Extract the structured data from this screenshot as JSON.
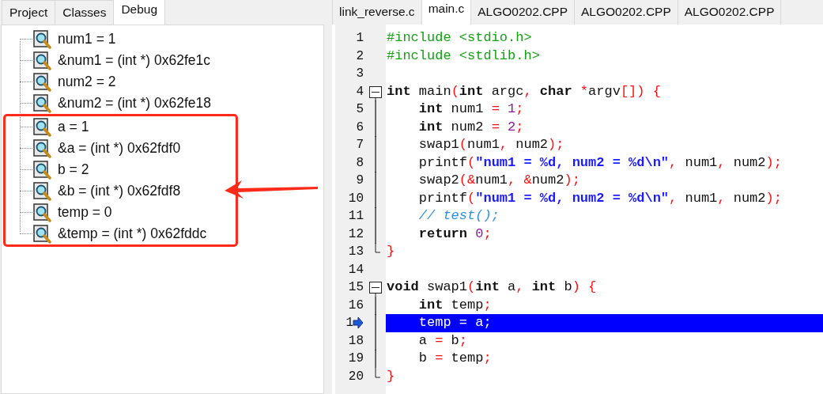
{
  "left_panel": {
    "tabs": [
      {
        "label": "Project",
        "selected": false
      },
      {
        "label": "Classes",
        "selected": false
      },
      {
        "label": "Debug",
        "selected": true
      }
    ],
    "watches": [
      {
        "label": "num1 = 1",
        "highlighted": false
      },
      {
        "label": "&num1 = (int *) 0x62fe1c",
        "highlighted": false
      },
      {
        "label": "num2 = 2",
        "highlighted": false
      },
      {
        "label": "&num2 = (int *) 0x62fe18",
        "highlighted": false
      },
      {
        "label": "a = 1",
        "highlighted": true
      },
      {
        "label": "&a = (int *) 0x62fdf0",
        "highlighted": true
      },
      {
        "label": "b = 2",
        "highlighted": true
      },
      {
        "label": "&b = (int *) 0x62fdf8",
        "highlighted": true
      },
      {
        "label": "temp = 0",
        "highlighted": true
      },
      {
        "label": "&temp = (int *) 0x62fddc",
        "highlighted": true
      }
    ]
  },
  "editor": {
    "tabs": [
      {
        "label": "link_reverse.c",
        "selected": false
      },
      {
        "label": "main.c",
        "selected": true
      },
      {
        "label": "ALGO0202.CPP",
        "selected": false
      },
      {
        "label": "ALGO0202.CPP",
        "selected": false
      },
      {
        "label": "ALGO0202.CPP",
        "selected": false
      }
    ],
    "lines": [
      {
        "number": "1",
        "current": false,
        "tokens": [
          {
            "kind": "preprocessor",
            "t": "#include <stdio.h>"
          }
        ]
      },
      {
        "number": "2",
        "current": false,
        "tokens": [
          {
            "kind": "preprocessor",
            "t": "#include <stdlib.h>"
          }
        ]
      },
      {
        "number": "3",
        "current": false
      },
      {
        "number": "4",
        "fold_toggle": true,
        "current": false,
        "tokens": [
          {
            "kind": "keyword",
            "t": "int"
          },
          {
            "kind": "identifier",
            "t": " main"
          },
          {
            "kind": "symbol",
            "t": "("
          },
          {
            "kind": "keyword",
            "t": "int"
          },
          {
            "kind": "identifier",
            "t": " argc"
          },
          {
            "kind": "symbol",
            "t": ","
          },
          {
            "kind": "keyword",
            "t": " char"
          },
          {
            "kind": "symbol",
            "t": " *"
          },
          {
            "kind": "identifier",
            "t": "argv"
          },
          {
            "kind": "symbol",
            "t": "[]) {"
          }
        ]
      },
      {
        "number": "5",
        "in_block": true,
        "current": false,
        "tokens": [
          {
            "kind": "keyword",
            "t": "    int"
          },
          {
            "kind": "identifier",
            "t": " num1 "
          },
          {
            "kind": "symbol",
            "t": "="
          },
          {
            "kind": "number",
            "t": " 1"
          },
          {
            "kind": "symbol",
            "t": ";"
          }
        ]
      },
      {
        "number": "6",
        "in_block": true,
        "current": false,
        "tokens": [
          {
            "kind": "keyword",
            "t": "    int"
          },
          {
            "kind": "identifier",
            "t": " num2 "
          },
          {
            "kind": "symbol",
            "t": "="
          },
          {
            "kind": "number",
            "t": " 2"
          },
          {
            "kind": "symbol",
            "t": ";"
          }
        ]
      },
      {
        "number": "7",
        "in_block": true,
        "current": false,
        "tokens": [
          {
            "kind": "identifier",
            "t": "    swap1"
          },
          {
            "kind": "symbol",
            "t": "("
          },
          {
            "kind": "identifier",
            "t": "num1"
          },
          {
            "kind": "symbol",
            "t": ","
          },
          {
            "kind": "identifier",
            "t": " num2"
          },
          {
            "kind": "symbol",
            "t": ");"
          }
        ]
      },
      {
        "number": "8",
        "in_block": true,
        "current": false,
        "tokens": [
          {
            "kind": "identifier",
            "t": "    printf"
          },
          {
            "kind": "symbol",
            "t": "("
          },
          {
            "kind": "string",
            "t": "\"num1 = %d, num2 = %d\\n\""
          },
          {
            "kind": "symbol",
            "t": ","
          },
          {
            "kind": "identifier",
            "t": " num1"
          },
          {
            "kind": "symbol",
            "t": ","
          },
          {
            "kind": "identifier",
            "t": " num2"
          },
          {
            "kind": "symbol",
            "t": ");"
          }
        ]
      },
      {
        "number": "9",
        "in_block": true,
        "current": false,
        "tokens": [
          {
            "kind": "identifier",
            "t": "    swap2"
          },
          {
            "kind": "symbol",
            "t": "(&"
          },
          {
            "kind": "identifier",
            "t": "num1"
          },
          {
            "kind": "symbol",
            "t": ", &"
          },
          {
            "kind": "identifier",
            "t": "num2"
          },
          {
            "kind": "symbol",
            "t": ");"
          }
        ]
      },
      {
        "number": "10",
        "in_block": true,
        "current": false,
        "tokens": [
          {
            "kind": "identifier",
            "t": "    printf"
          },
          {
            "kind": "symbol",
            "t": "("
          },
          {
            "kind": "string",
            "t": "\"num1 = %d, num2 = %d\\n\""
          },
          {
            "kind": "symbol",
            "t": ","
          },
          {
            "kind": "identifier",
            "t": " num1"
          },
          {
            "kind": "symbol",
            "t": ","
          },
          {
            "kind": "identifier",
            "t": " num2"
          },
          {
            "kind": "symbol",
            "t": ");"
          }
        ]
      },
      {
        "number": "11",
        "in_block": true,
        "current": false,
        "tokens": [
          {
            "kind": "comment",
            "t": "    // test();"
          }
        ]
      },
      {
        "number": "12",
        "in_block": true,
        "current": false,
        "tokens": [
          {
            "kind": "keyword",
            "t": "    return"
          },
          {
            "kind": "number",
            "t": " 0"
          },
          {
            "kind": "symbol",
            "t": ";"
          }
        ]
      },
      {
        "number": "13",
        "block_end": true,
        "current": false,
        "tokens": [
          {
            "kind": "symbol",
            "t": "}"
          }
        ]
      },
      {
        "number": "14",
        "current": false
      },
      {
        "number": "15",
        "fold_toggle": true,
        "current": false,
        "tokens": [
          {
            "kind": "keyword",
            "t": "void"
          },
          {
            "kind": "identifier",
            "t": " swap1"
          },
          {
            "kind": "symbol",
            "t": "("
          },
          {
            "kind": "keyword",
            "t": "int"
          },
          {
            "kind": "identifier",
            "t": " a"
          },
          {
            "kind": "symbol",
            "t": ","
          },
          {
            "kind": "keyword",
            "t": " int"
          },
          {
            "kind": "identifier",
            "t": " b"
          },
          {
            "kind": "symbol",
            "t": ") {"
          }
        ]
      },
      {
        "number": "16",
        "in_block": true,
        "current": false,
        "tokens": [
          {
            "kind": "keyword",
            "t": "    int"
          },
          {
            "kind": "identifier",
            "t": " temp"
          },
          {
            "kind": "symbol",
            "t": ";"
          }
        ]
      },
      {
        "number": "1",
        "in_block": true,
        "current": true,
        "tokens": [
          {
            "kind": "identifier",
            "t": "    temp "
          },
          {
            "kind": "symbol",
            "t": "="
          },
          {
            "kind": "identifier",
            "t": " a"
          },
          {
            "kind": "symbol",
            "t": ";"
          }
        ]
      },
      {
        "number": "18",
        "in_block": true,
        "current": false,
        "tokens": [
          {
            "kind": "identifier",
            "t": "    a "
          },
          {
            "kind": "symbol",
            "t": "="
          },
          {
            "kind": "identifier",
            "t": " b"
          },
          {
            "kind": "symbol",
            "t": ";"
          }
        ]
      },
      {
        "number": "19",
        "in_block": true,
        "current": false,
        "tokens": [
          {
            "kind": "identifier",
            "t": "    b "
          },
          {
            "kind": "symbol",
            "t": "="
          },
          {
            "kind": "identifier",
            "t": " temp"
          },
          {
            "kind": "symbol",
            "t": ";"
          }
        ]
      },
      {
        "number": "20",
        "block_end": true,
        "current": false,
        "tokens": [
          {
            "kind": "symbol",
            "t": "}"
          }
        ]
      }
    ]
  }
}
